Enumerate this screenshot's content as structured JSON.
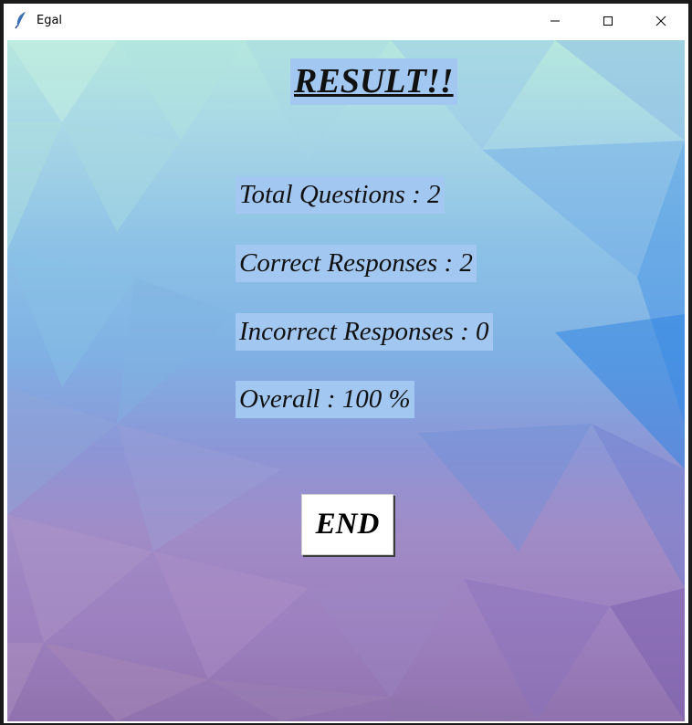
{
  "window": {
    "title": "Egal",
    "controls": [
      "minimize-icon",
      "maximize-icon",
      "close-icon"
    ]
  },
  "result": {
    "title": "RESULT!!",
    "total_questions": "Total Questions : 2",
    "correct_responses": "Correct Responses : 2",
    "incorrect_responses": "Incorrect Responses : 0",
    "overall": "Overall : 100 %"
  },
  "actions": {
    "end_label": "END"
  },
  "colors": {
    "label_background": "#a2c8f2",
    "background_top": "#b6e8de",
    "background_middle": "#7fb1e4",
    "background_bottom": "#8f72ad"
  }
}
